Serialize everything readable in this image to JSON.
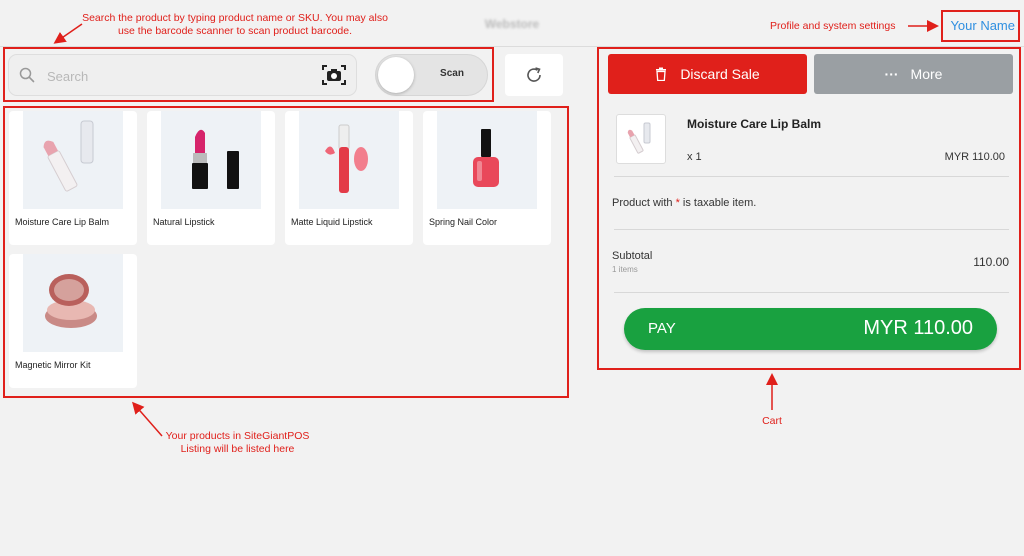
{
  "header": {
    "store_name": "Webstore",
    "user_name": "Your Name"
  },
  "search": {
    "placeholder": "Search",
    "scan_label": "Scan"
  },
  "products": [
    {
      "name": "Moisture Care Lip Balm"
    },
    {
      "name": "Natural Lipstick"
    },
    {
      "name": "Matte Liquid Lipstick"
    },
    {
      "name": "Spring Nail Color"
    },
    {
      "name": "Magnetic Mirror Kit"
    }
  ],
  "cart": {
    "discard_label": "Discard Sale",
    "more_label": "More",
    "more_icon_glyph": "···",
    "item": {
      "name": "Moisture Care Lip Balm",
      "qty": "x 1",
      "price": "MYR 110.00"
    },
    "tax_note_prefix": "Product with ",
    "tax_note_star": "*",
    "tax_note_suffix": " is taxable item.",
    "subtotal_label": "Subtotal",
    "subtotal_items": "1 items",
    "subtotal_value": "110.00",
    "pay_label": "PAY",
    "pay_amount": "MYR 110.00"
  },
  "annotations": {
    "search": "Search the product by typing product name or SKU. You may also use the barcode scanner to scan product barcode.",
    "profile": "Profile and system settings",
    "products": "Your products in SiteGiantPOS Listing will be listed here",
    "cart": "Cart"
  },
  "colors": {
    "annotation_red": "#e0201b",
    "discard_red": "#e0201b",
    "more_gray": "#9a9fa3",
    "pay_green": "#19a140",
    "link_blue": "#2f8fe0"
  }
}
